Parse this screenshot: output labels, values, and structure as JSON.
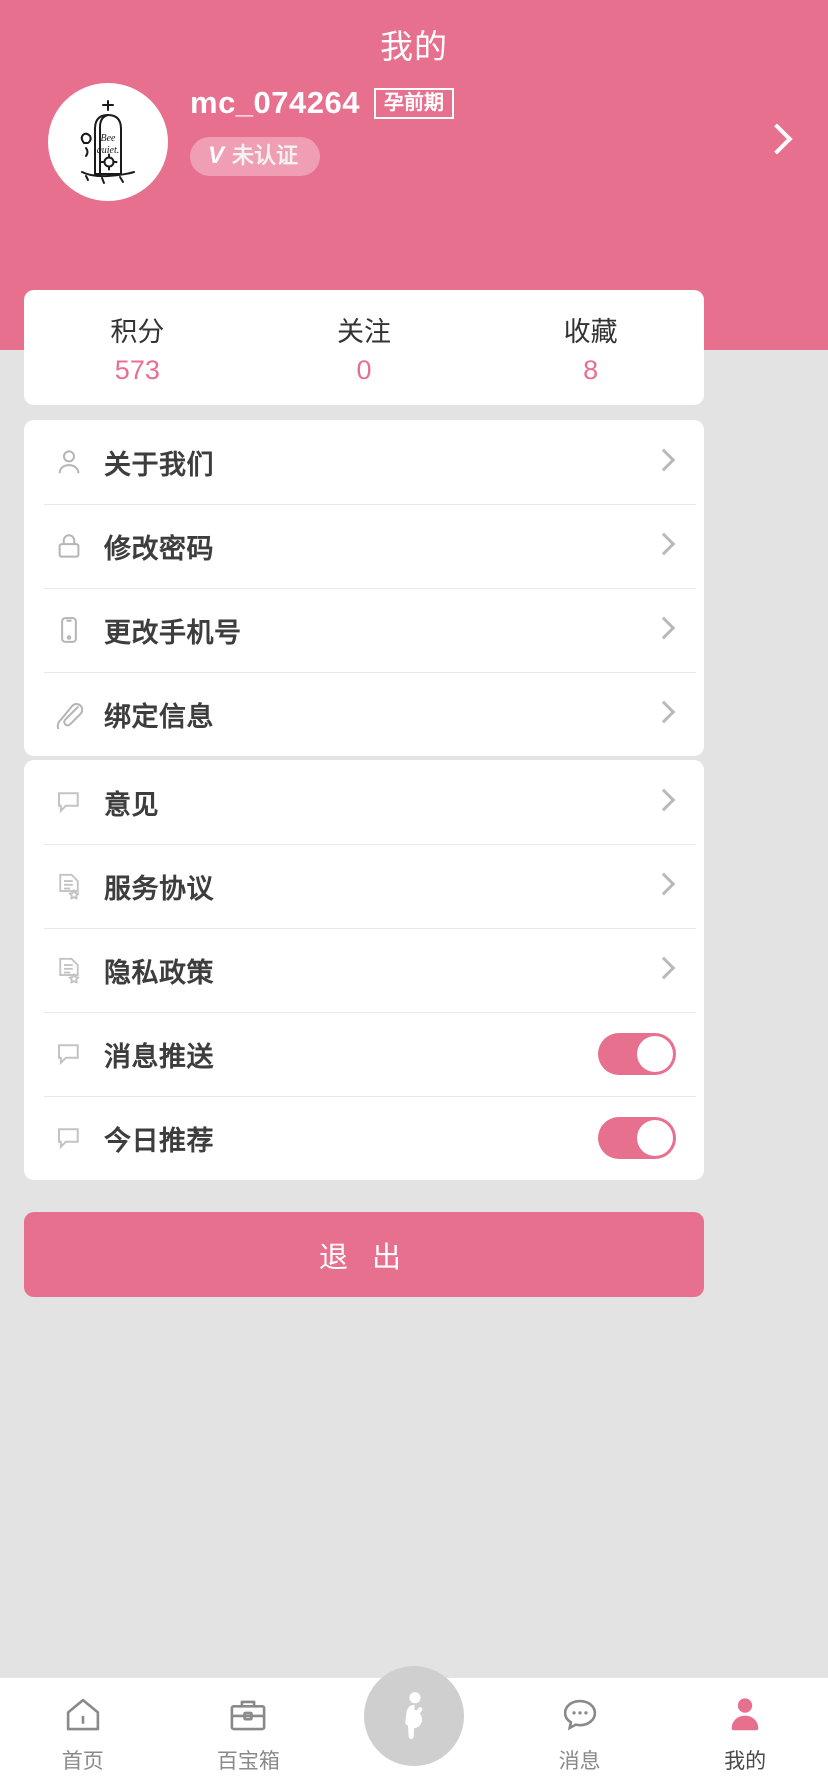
{
  "header": {
    "title": "我的",
    "username": "mc_074264",
    "stage_badge": "孕前期",
    "verify_mark": "V",
    "verify_label": "未认证",
    "bg_color": "#e8708f",
    "avatar_caption": "Bee quiet."
  },
  "stats": [
    {
      "label": "积分",
      "value": "573"
    },
    {
      "label": "关注",
      "value": "0"
    },
    {
      "label": "收藏",
      "value": "8"
    }
  ],
  "menu_group_1": [
    {
      "label": "关于我们",
      "icon": "person-icon"
    },
    {
      "label": "修改密码",
      "icon": "lock-icon"
    },
    {
      "label": "更改手机号",
      "icon": "phone-icon"
    },
    {
      "label": "绑定信息",
      "icon": "paperclip-icon"
    }
  ],
  "menu_group_2": [
    {
      "label": "意见",
      "icon": "chat-bubble-icon",
      "control": "chevron"
    },
    {
      "label": "服务协议",
      "icon": "document-star-icon",
      "control": "chevron"
    },
    {
      "label": "隐私政策",
      "icon": "document-star-icon",
      "control": "chevron"
    },
    {
      "label": "消息推送",
      "icon": "chat-bubble-icon",
      "control": "toggle",
      "toggle_on": true
    },
    {
      "label": "今日推荐",
      "icon": "chat-bubble-icon",
      "control": "toggle",
      "toggle_on": true
    }
  ],
  "logout": {
    "label": "退 出",
    "color": "#e8708f"
  },
  "tabbar": [
    {
      "label": "首页",
      "icon": "home-icon",
      "active": false
    },
    {
      "label": "百宝箱",
      "icon": "toolbox-icon",
      "active": false
    },
    {
      "label": "",
      "icon": "pregnant-woman-icon",
      "active": false
    },
    {
      "label": "消息",
      "icon": "message-icon",
      "active": false
    },
    {
      "label": "我的",
      "icon": "user-profile-icon",
      "active": true
    }
  ],
  "colors": {
    "accent": "#e8708f",
    "page_bg": "#e3e3e3",
    "card_bg": "#ffffff",
    "text_primary": "#3d3d3d",
    "text_muted": "#8a8a8a"
  }
}
